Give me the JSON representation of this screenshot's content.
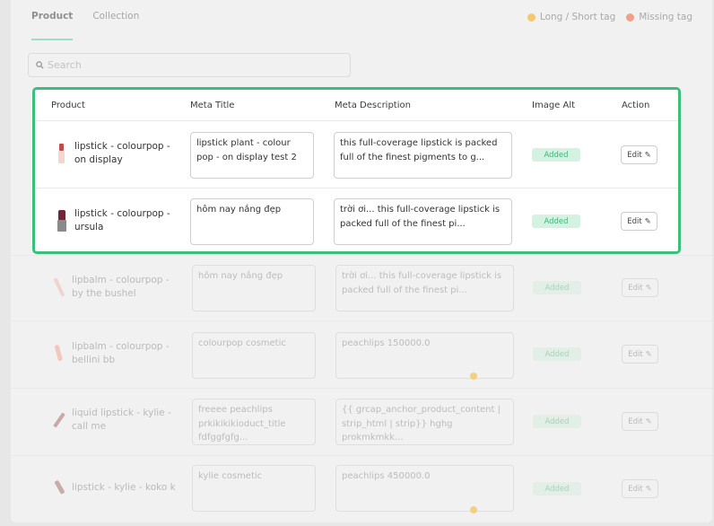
{
  "tabs": [
    {
      "label": "Product"
    },
    {
      "label": "Collection"
    }
  ],
  "legend": [
    {
      "label": "Long / Short tag",
      "color": "#f5c86f"
    },
    {
      "label": "Missing tag",
      "color": "#f0a087"
    }
  ],
  "search": {
    "placeholder": "Search"
  },
  "table": {
    "headers": {
      "product": "Product",
      "meta_title": "Meta Title",
      "meta_description": "Meta Description",
      "image_alt": "Image Alt",
      "action": "Action"
    },
    "highlighted_rows": [
      {
        "product": "lipstick - colourpop - on display",
        "meta_title": "lipstick plant - colour pop - on display test 2",
        "meta_description": "this full-coverage lipstick is packed full of the finest pigments to g...",
        "image_alt": "Added",
        "action": "Edit"
      },
      {
        "product": "lipstick - colourpop - ursula",
        "meta_title": "hôm nay nắng đẹp",
        "meta_description": "trời ơi... this full-coverage lipstick is packed full of the finest pi...",
        "image_alt": "Added",
        "action": "Edit"
      }
    ],
    "other_rows": [
      {
        "product": "lipbalm - colourpop - by the bushel",
        "meta_title": "hôm nay nắng đẹp",
        "meta_description": "trời ơi... this full-coverage lipstick is packed full of the finest pi...",
        "image_alt": "Added",
        "action": "Edit"
      },
      {
        "product": "lipbalm - colourpop - bellini bb",
        "meta_title": "colourpop cosmetic",
        "meta_description": "peachlips 150000.0",
        "image_alt": "Added",
        "action": "Edit"
      },
      {
        "product": "liquid lipstick - kylie - call me",
        "meta_title": "freeee peachlips prkikikikioduct_title fdfggfgfg...",
        "meta_description": "{{ grcap_anchor_product_content | strip_html | strip}} hghg prokmkmkk...",
        "image_alt": "Added",
        "action": "Edit"
      },
      {
        "product": "lipstick - kylie - koko k",
        "meta_title": "kylie cosmetic",
        "meta_description": "peachlips 450000.0",
        "image_alt": "Added",
        "action": "Edit"
      }
    ]
  }
}
